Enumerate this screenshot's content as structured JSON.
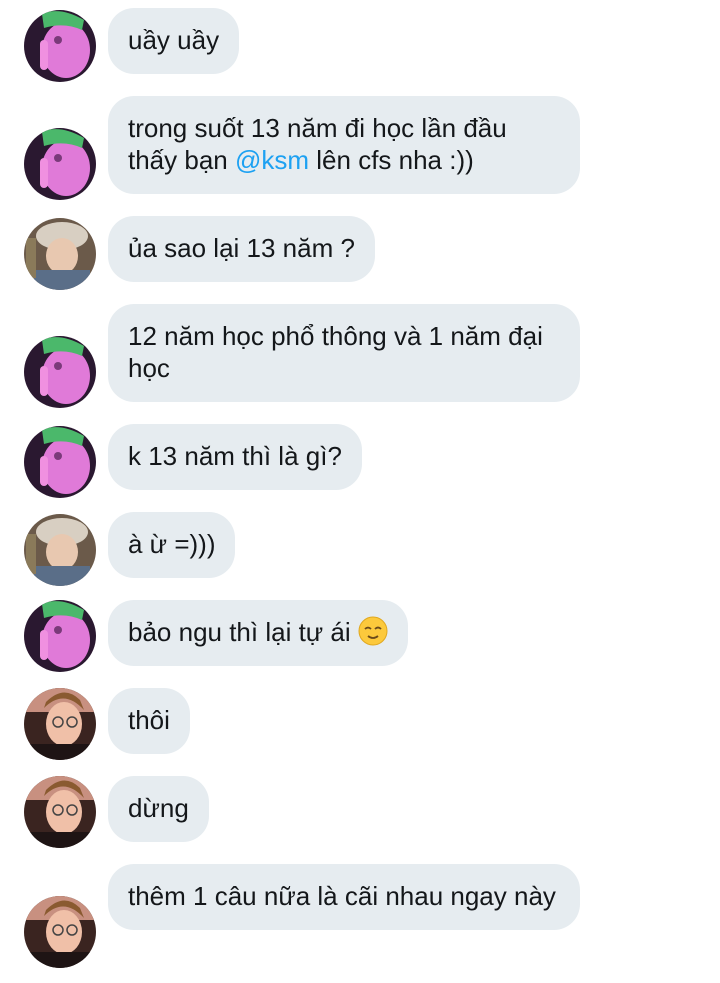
{
  "messages": [
    {
      "sender": "user_a",
      "text": "uầy uầy"
    },
    {
      "sender": "user_a",
      "text_before": "trong suốt 13 năm đi học lần đầu thấy bạn ",
      "mention": "@ksm",
      "text_after": " lên cfs nha :))"
    },
    {
      "sender": "user_b",
      "text": "ủa sao lại 13 năm ?"
    },
    {
      "sender": "user_a",
      "text": "12 năm học phổ thông và 1 năm đại học"
    },
    {
      "sender": "user_a",
      "text": "k 13 năm thì là gì?"
    },
    {
      "sender": "user_b",
      "text": "à ừ =)))"
    },
    {
      "sender": "user_a",
      "text": "bảo ngu thì lại tự ái ",
      "emoji": "relieved-face-emoji"
    },
    {
      "sender": "user_c",
      "text": "thôi"
    },
    {
      "sender": "user_c",
      "text": "dừng"
    },
    {
      "sender": "user_c",
      "text": "thêm 1 câu nữa là cãi nhau ngay này"
    }
  ],
  "colors": {
    "bubble": "#e6ecf0",
    "text": "#14171a",
    "mention": "#1da1f2"
  }
}
